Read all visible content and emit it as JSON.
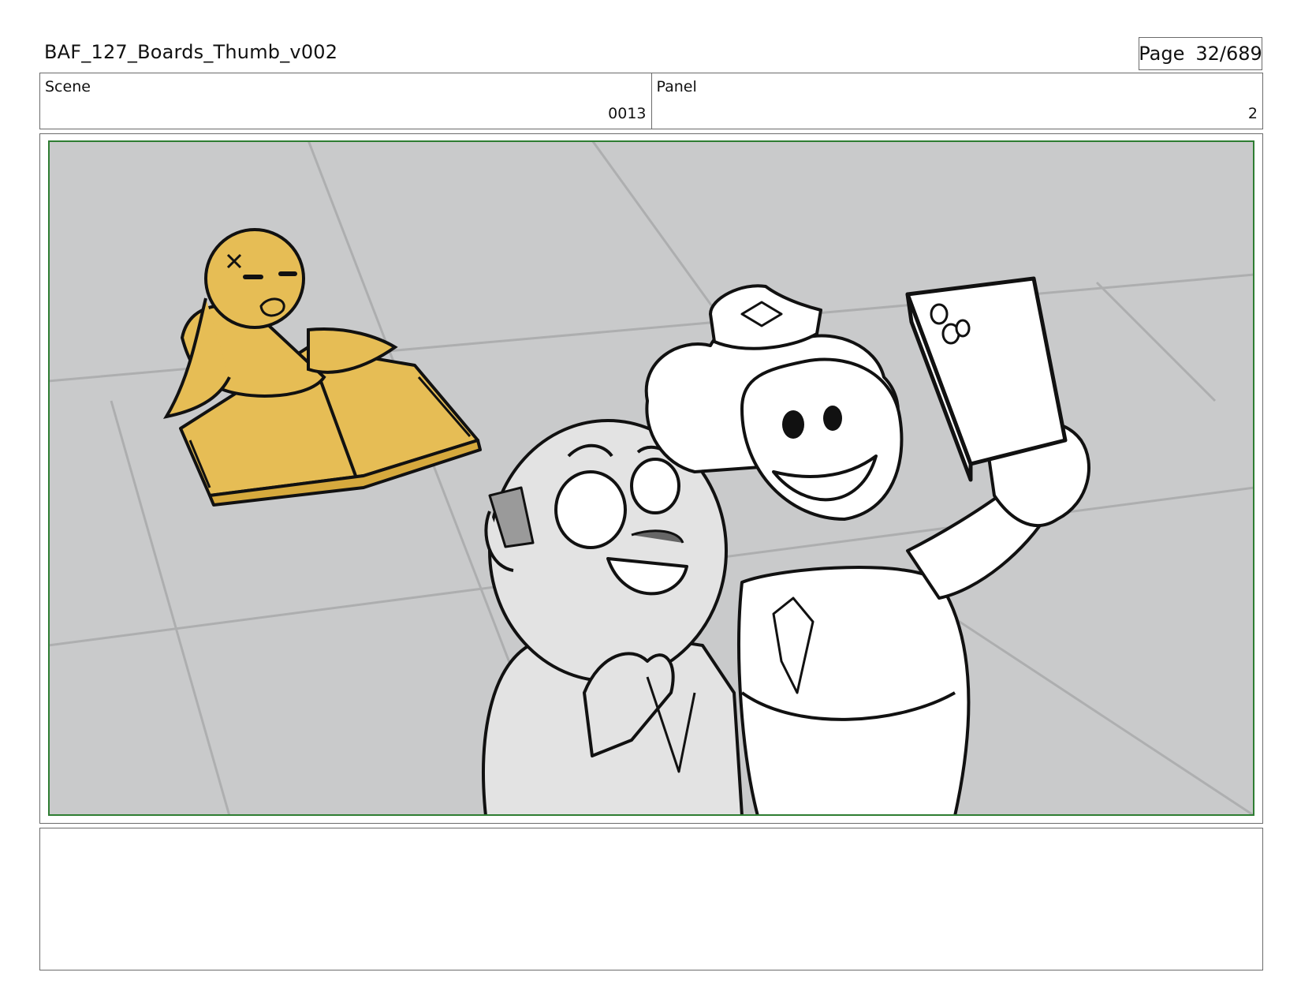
{
  "document": {
    "title": "BAF_127_Boards_Thumb_v002",
    "page_label": "Page",
    "page_number": "32/689"
  },
  "header": {
    "scene_label": "Scene",
    "scene_value": "0013",
    "panel_label": "Panel",
    "panel_value": "2"
  },
  "panel": {
    "frame_color": "#2e7d32",
    "background_color": "#c9cacb",
    "accent_color": "#e6bd55",
    "depicts": [
      "yellow-bird-icon",
      "open-book-icon",
      "bald-man-character",
      "curly-haired-officer-character",
      "phone-icon"
    ]
  },
  "notes": {
    "text": ""
  }
}
